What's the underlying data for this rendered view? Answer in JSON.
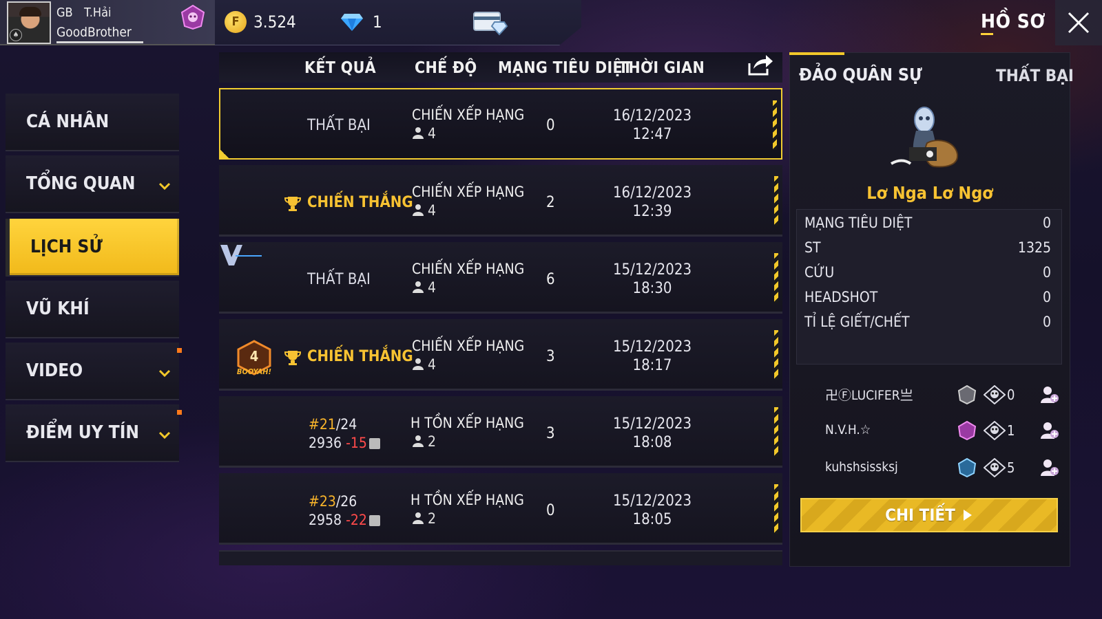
{
  "player": {
    "guild_tag": "GB",
    "guild_name": "T.Hải",
    "name": "GoodBrother"
  },
  "currency": {
    "gold": "3.524",
    "diamonds": "1"
  },
  "header": {
    "profile_tab": "HỒ SƠ"
  },
  "sidebar": {
    "items": [
      {
        "label": "CÁ NHÂN"
      },
      {
        "label": "TỔNG QUAN"
      },
      {
        "label": "LỊCH SỬ"
      },
      {
        "label": "VŨ KHÍ"
      },
      {
        "label": "VIDEO"
      },
      {
        "label": "ĐIỂM UY TÍN"
      }
    ]
  },
  "table": {
    "headers": [
      "KẾT QUẢ",
      "CHẾ ĐỘ",
      "MẠNG TIÊU DIỆT",
      "THỜI GIAN"
    ],
    "rows": [
      {
        "result": "THẤT BẠI",
        "mode": "CHIẾN XẾP HẠNG",
        "party": "4",
        "kills": "0",
        "date": "16/12/2023",
        "time": "12:47"
      },
      {
        "result": "CHIẾN THẮNG",
        "mode": "CHIẾN XẾP HẠNG",
        "party": "4",
        "kills": "2",
        "date": "16/12/2023",
        "time": "12:39"
      },
      {
        "result": "THẤT BẠI",
        "mode": "CHIẾN XẾP HẠNG",
        "party": "4",
        "kills": "6",
        "date": "15/12/2023",
        "time": "18:30"
      },
      {
        "result": "CHIẾN THẮNG",
        "mode": "CHIẾN XẾP HẠNG",
        "party": "4",
        "kills": "3",
        "date": "15/12/2023",
        "time": "18:17",
        "badge_number": "4",
        "badge_text": "BOOYAH!"
      },
      {
        "rank_pos": "#21",
        "rank_total": "/24",
        "points": "2936",
        "points_delta": "-15",
        "mode": "H TỒN XẾP HẠNG",
        "party": "2",
        "kills": "3",
        "date": "15/12/2023",
        "time": "18:08"
      },
      {
        "rank_pos": "#23",
        "rank_total": "/26",
        "points": "2958",
        "points_delta": "-22",
        "mode": "H TỒN XẾP HẠNG",
        "party": "2",
        "kills": "0",
        "date": "15/12/2023",
        "time": "18:05"
      }
    ]
  },
  "detail": {
    "map_name": "ĐẢO QUÂN SỰ",
    "result": "THẤT BẠI",
    "character_name": "Lơ Nga Lơ Ngơ",
    "stats": [
      {
        "label": "MẠNG TIÊU DIỆT",
        "value": "0"
      },
      {
        "label": "ST",
        "value": "1325"
      },
      {
        "label": "CỨU",
        "value": "0"
      },
      {
        "label": "HEADSHOT",
        "value": "0"
      },
      {
        "label": "TỈ LỆ GIẾT/CHẾT",
        "value": "0"
      }
    ],
    "teammates": [
      {
        "name": "卍ⒻLUCIFER亗",
        "kills": "0"
      },
      {
        "name": "N.V.H.☆",
        "kills": "1"
      },
      {
        "name": "kuhshsissksj",
        "kills": "5"
      }
    ],
    "detail_button": "CHI TIẾT"
  },
  "colors": {
    "accent": "#f2c82a",
    "win": "#f7c232",
    "negative": "#ff4a4a"
  }
}
